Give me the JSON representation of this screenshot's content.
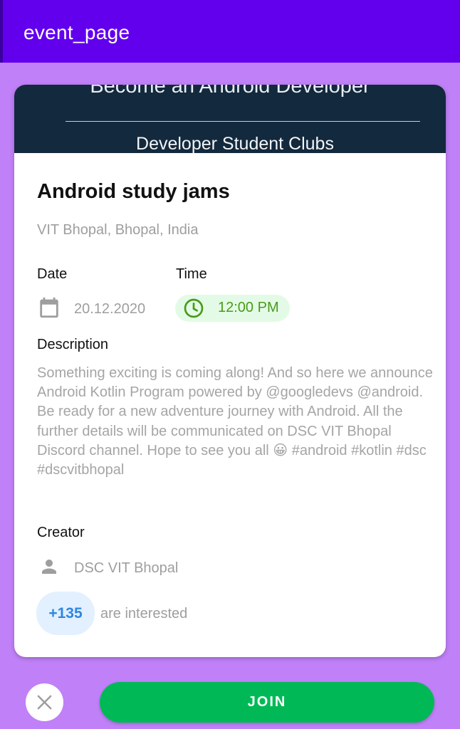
{
  "app": {
    "title": "event_page"
  },
  "banner": {
    "headline": "Become an Android Developer",
    "subtitle": "Developer Student Clubs"
  },
  "event": {
    "title": "Android study jams",
    "location": "VIT Bhopal, Bhopal, India",
    "date_label": "Date",
    "date": "20.12.2020",
    "time_label": "Time",
    "time": "12:00 PM",
    "description_label": "Description",
    "description": "Something exciting is coming along! And so here we announce Android Kotlin Program powered by @googledevs @android. Be ready for a new adventure journey with Android. All the further details will be communicated on DSC VIT Bhopal Discord channel. Hope to see you all 😀 #android #kotlin #dsc #dscvitbhopal",
    "creator_label": "Creator",
    "creator": "DSC VIT Bhopal",
    "interested_count": "+135",
    "interested_text": "are interested"
  },
  "actions": {
    "join_label": "JOIN"
  },
  "icons": {
    "calendar": "calendar-icon",
    "clock": "clock-icon",
    "person": "person-icon",
    "close": "close-icon"
  },
  "colors": {
    "app_bar": "#6200ee",
    "background": "#c080f8",
    "join": "#00b956",
    "time_chip": "#e3fbe6",
    "time_text": "#4a9a1a",
    "interest_badge": "#e2f0ff",
    "interest_text": "#2f86e0"
  }
}
